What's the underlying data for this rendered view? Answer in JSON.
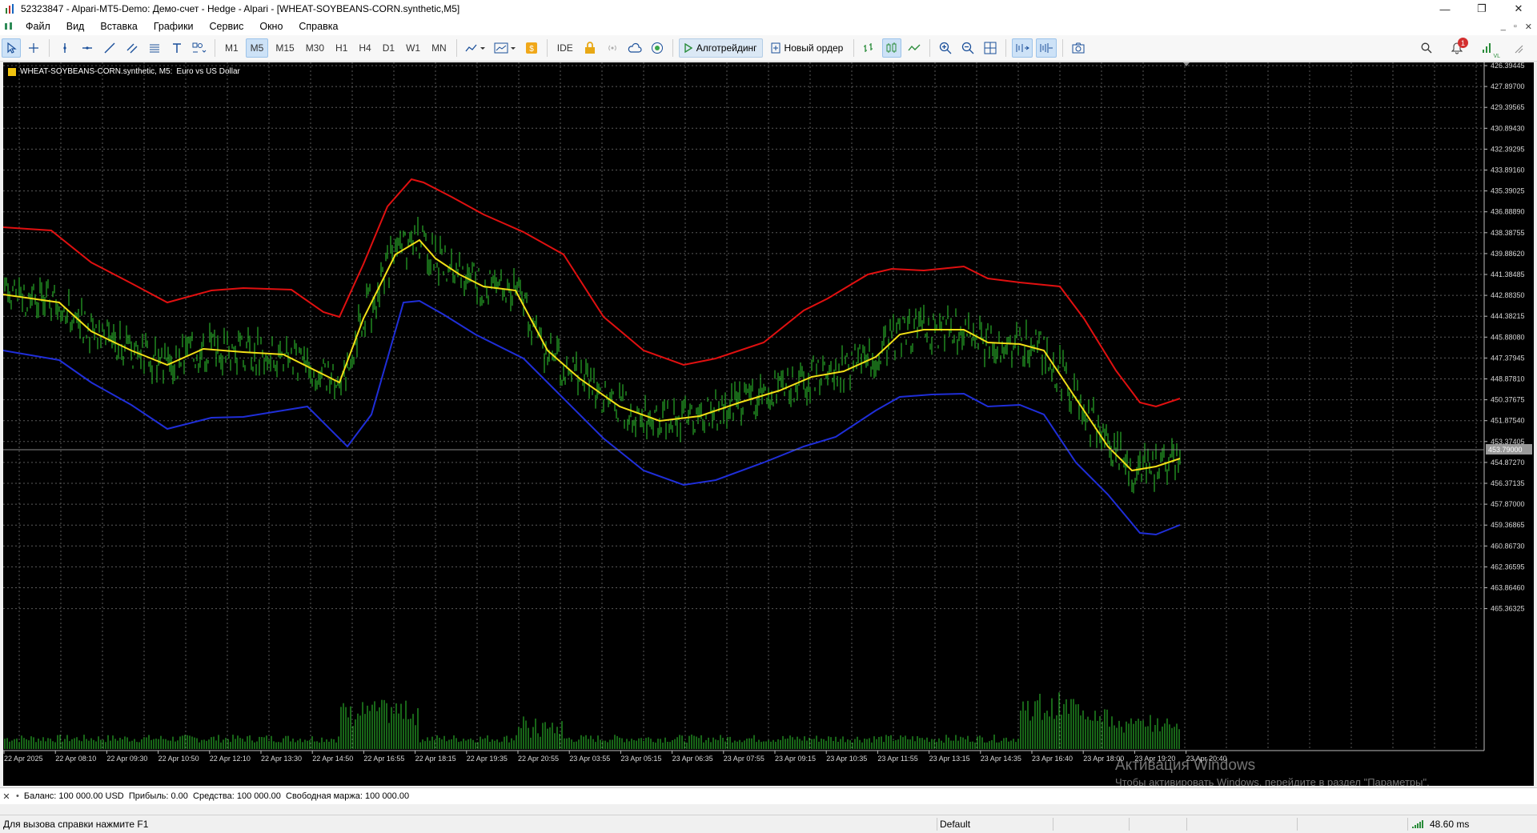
{
  "window": {
    "title": "52323847 - Alpari-MT5-Demo: Демо-счет - Hedge - Alpari - [WHEAT-SOYBEANS-CORN.synthetic,M5]",
    "controls": {
      "minimize": "—",
      "restore": "❐",
      "close": "✕"
    }
  },
  "menu": {
    "items": [
      "Файл",
      "Вид",
      "Вставка",
      "Графики",
      "Сервис",
      "Окно",
      "Справка"
    ],
    "mdi_controls": {
      "minimize": "_",
      "restore": "▫",
      "close": "✕"
    }
  },
  "toolbar": {
    "timeframes": [
      "M1",
      "M5",
      "M15",
      "M30",
      "H1",
      "H4",
      "D1",
      "W1",
      "MN"
    ],
    "active_timeframe": "M5",
    "ide_label": "IDE",
    "algotrading_label": "Алготрейдинг",
    "new_order_label": "Новый ордер",
    "notification_count": "1",
    "signal_label": "VL"
  },
  "chart": {
    "caption_symbol": "WHEAT-SOYBEANS-CORN.synthetic, M5:",
    "caption_description": "Euro vs US Dollar",
    "current_price": "453.79000",
    "accent_colors": {
      "upper_band": "#e01010",
      "middle_band": "#f2df16",
      "lower_band": "#1f2ed8",
      "candles": "#2fcc2f",
      "volume": "#2fcc2f"
    },
    "price_axis": [
      "426.39445",
      "427.89700",
      "429.39565",
      "430.89430",
      "432.39295",
      "433.89160",
      "435.39025",
      "436.88890",
      "438.38755",
      "439.88620",
      "441.38485",
      "442.88350",
      "444.38215",
      "445.88080",
      "447.37945",
      "448.87810",
      "450.37675",
      "451.87540",
      "453.37405",
      "454.87270",
      "456.37135",
      "457.87000",
      "459.36865",
      "460.86730",
      "462.36595",
      "463.86460",
      "465.36325"
    ],
    "time_axis": [
      "22 Apr 2025",
      "22 Apr 08:10",
      "22 Apr 09:30",
      "22 Apr 10:50",
      "22 Apr 12:10",
      "22 Apr 13:30",
      "22 Apr 14:50",
      "22 Apr 16:55",
      "22 Apr 18:15",
      "22 Apr 19:35",
      "22 Apr 20:55",
      "23 Apr 03:55",
      "23 Apr 05:15",
      "23 Apr 06:35",
      "23 Apr 07:55",
      "23 Apr 09:15",
      "23 Apr 10:35",
      "23 Apr 11:55",
      "23 Apr 13:15",
      "23 Apr 14:35",
      "23 Apr 16:40",
      "23 Apr 18:00",
      "23 Apr 19:20",
      "23 Apr 20:40"
    ]
  },
  "account": {
    "summary": "Баланс: 100 000.00 USD  Прибыль: 0.00  Средства: 100 000.00  Свободная маржа: 100 000.00"
  },
  "watermark": {
    "line1": "Активация Windows",
    "line2": "Чтобы активировать Windows, перейдите в раздел \"Параметры\"."
  },
  "status": {
    "help": "Для вызова справки нажмите F1",
    "profile": "Default",
    "ping": "48.60 ms"
  }
}
